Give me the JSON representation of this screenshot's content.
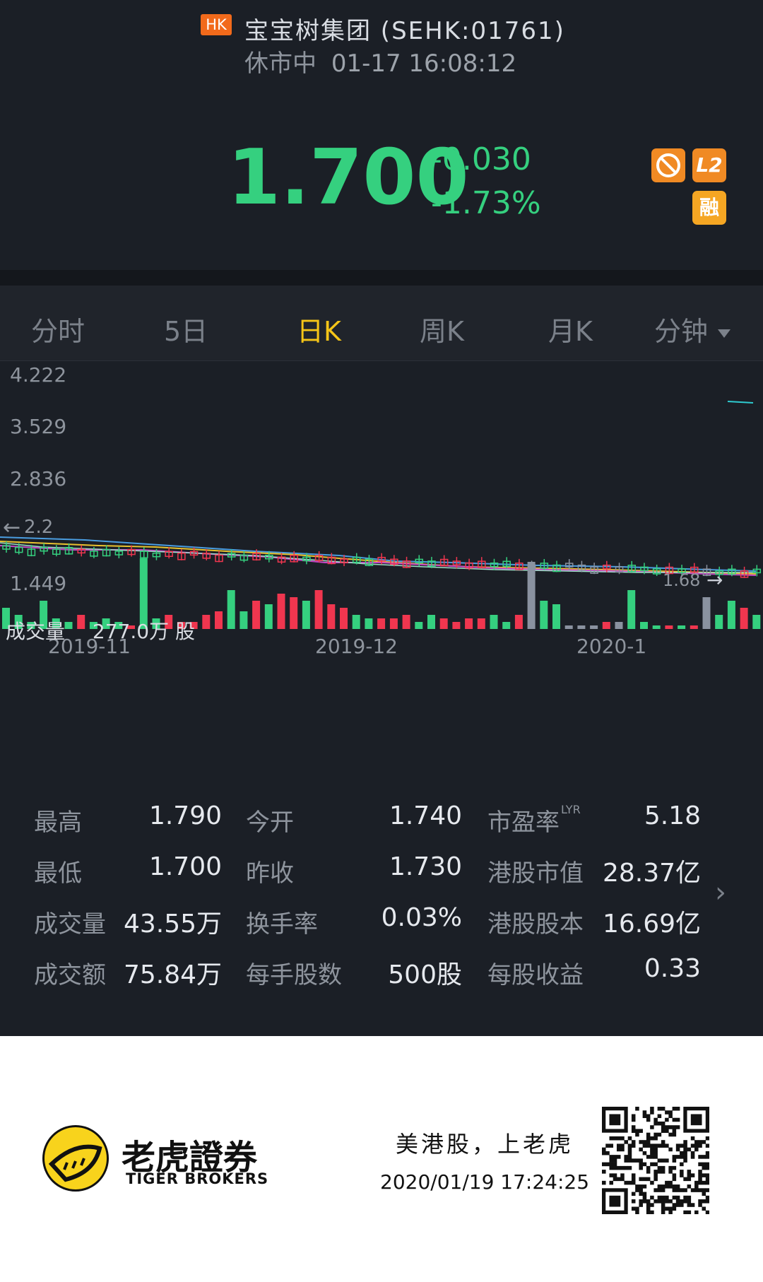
{
  "header": {
    "market_badge": "HK",
    "stock_title": "宝宝树集团 (SEHK:01761)",
    "status": "休市中",
    "datetime": "01-17 16:08:12",
    "price": "1.700",
    "change": "-0.030",
    "change_pct": "-1.73%",
    "badges": [
      "L2",
      "融"
    ],
    "colors": {
      "up": "#f0364f",
      "down": "#35d07f",
      "accent": "#f5c518"
    }
  },
  "tabs": [
    {
      "label": "分时"
    },
    {
      "label": "5日"
    },
    {
      "label": "日K"
    },
    {
      "label": "周K"
    },
    {
      "label": "月K"
    },
    {
      "label": "分钟"
    }
  ],
  "chart": {
    "y_labels": [
      "4.222",
      "3.529",
      "2.836",
      "2.2",
      "1.449"
    ],
    "last_label": "1.68",
    "volume_label": "成交量",
    "volume_value": "277.0万 股",
    "x_labels": [
      "2019-11",
      "2019-12",
      "2020-1"
    ]
  },
  "chart_data": {
    "type": "bar",
    "title": "成交量",
    "categories": [
      "2019-11",
      "2019-12",
      "2020-1"
    ],
    "series": [
      {
        "values": [
          0.3,
          0.2,
          0.1,
          0.4,
          0.15,
          0.1,
          0.2,
          0.1,
          0.15,
          0.1,
          0.05,
          1.0,
          0.15,
          0.2,
          0.1,
          0.1,
          0.2,
          0.25,
          0.55,
          0.25,
          0.4,
          0.35,
          0.5,
          0.45,
          0.4,
          0.55,
          0.35,
          0.3,
          0.2,
          0.15,
          0.15,
          0.15,
          0.2,
          0.1,
          0.2,
          0.15,
          0.1,
          0.15,
          0.15,
          0.2,
          0.1,
          0.2,
          0.95,
          0.4,
          0.35,
          0.05,
          0.05,
          0.05,
          0.1,
          0.1,
          0.55,
          0.1,
          0.05,
          0.05,
          0.05,
          0.05,
          0.45,
          0.2,
          0.4,
          0.3,
          0.2
        ]
      }
    ],
    "colors": [
      "g",
      "g",
      "g",
      "g",
      "g",
      "g",
      "r",
      "g",
      "g",
      "g",
      "r",
      "g",
      "g",
      "r",
      "r",
      "r",
      "r",
      "r",
      "g",
      "g",
      "r",
      "g",
      "r",
      "r",
      "g",
      "r",
      "r",
      "r",
      "g",
      "g",
      "r",
      "r",
      "r",
      "g",
      "g",
      "r",
      "r",
      "r",
      "r",
      "g",
      "g",
      "r",
      "n",
      "g",
      "g",
      "n",
      "n",
      "n",
      "r",
      "n",
      "g",
      "g",
      "g",
      "r",
      "g",
      "r",
      "n",
      "g",
      "g",
      "r",
      "g"
    ],
    "ylim_price": [
      1.449,
      4.222
    ]
  },
  "stats": {
    "rows": [
      [
        {
          "label": "最高",
          "value": "1.790"
        },
        {
          "label": "今开",
          "value": "1.740"
        },
        {
          "label": "市盈率",
          "sup": "LYR",
          "value": "5.18"
        }
      ],
      [
        {
          "label": "最低",
          "value": "1.700"
        },
        {
          "label": "昨收",
          "value": "1.730"
        },
        {
          "label": "港股市值",
          "value": "28.37亿"
        }
      ],
      [
        {
          "label": "成交量",
          "value": "43.55万"
        },
        {
          "label": "换手率",
          "value": "0.03%"
        },
        {
          "label": "港股股本",
          "value": "16.69亿"
        }
      ],
      [
        {
          "label": "成交额",
          "value": "75.84万"
        },
        {
          "label": "每手股数",
          "value": "500股"
        },
        {
          "label": "每股收益",
          "value": "0.33"
        }
      ]
    ]
  },
  "footer": {
    "brand_cn": "老虎證券",
    "brand_en": "TIGER BROKERS",
    "slogan": "美港股，上老虎",
    "datetime": "2020/01/19 17:24:25"
  }
}
